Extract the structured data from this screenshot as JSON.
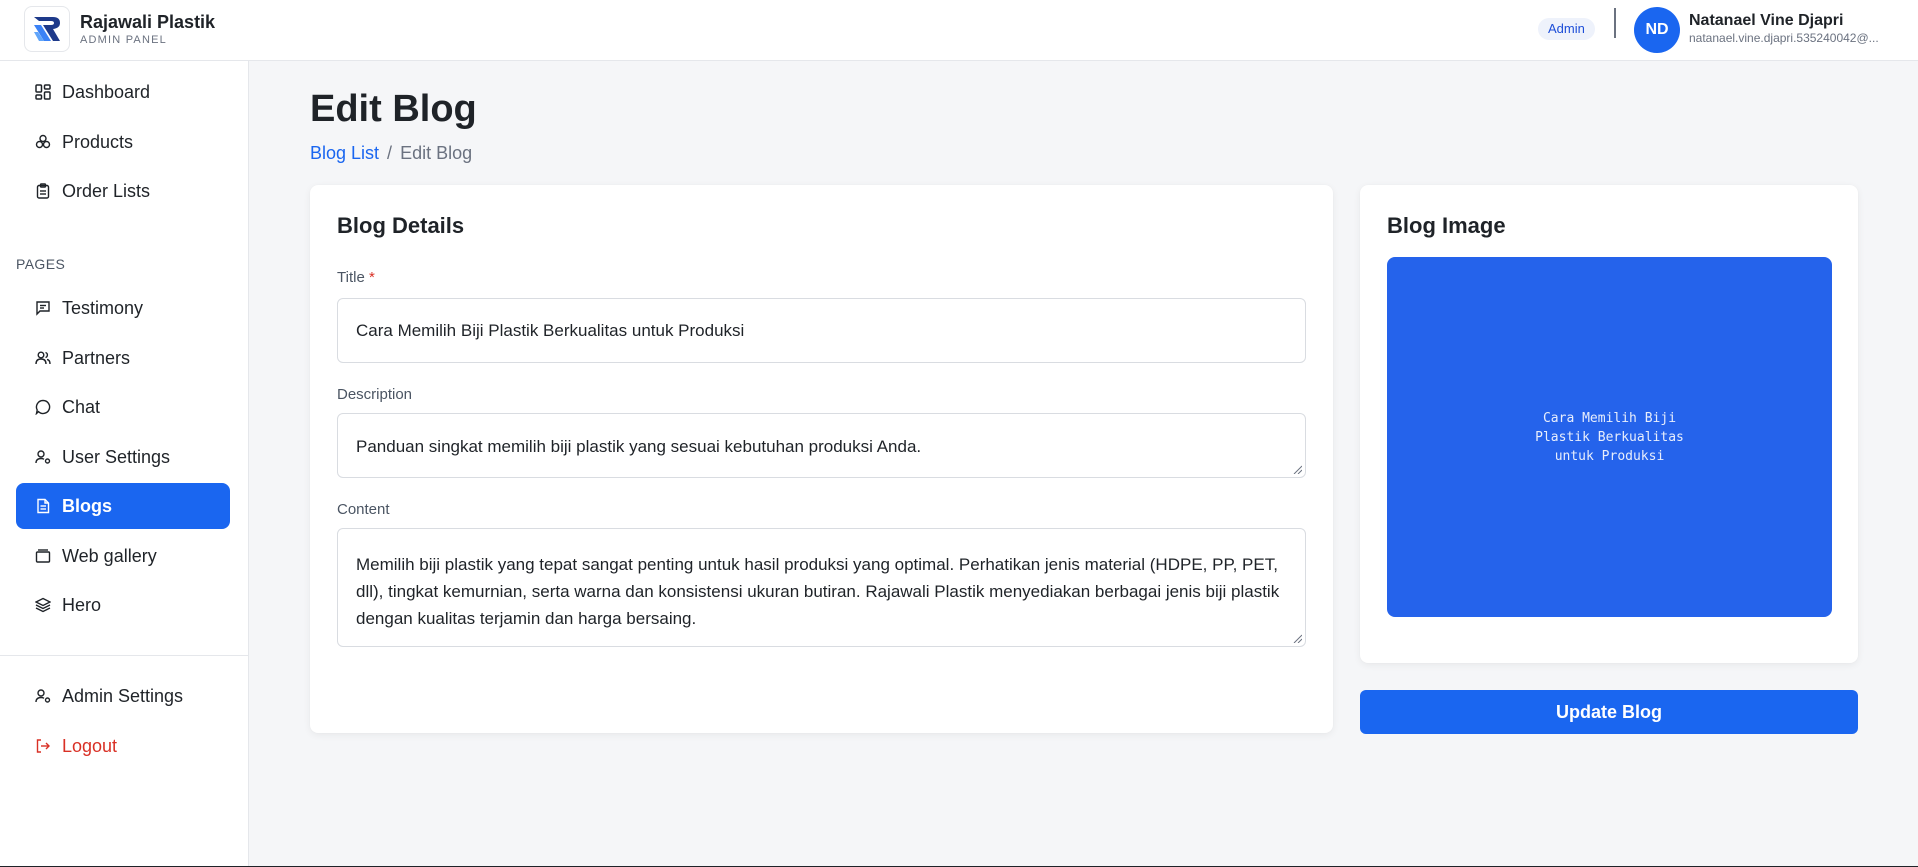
{
  "brand": {
    "name": "Rajawali Plastik",
    "subtitle": "ADMIN PANEL"
  },
  "header": {
    "role": "Admin",
    "user_initials": "ND",
    "user_name": "Natanael Vine Djapri",
    "user_email": "natanael.vine.djapri.535240042@..."
  },
  "sidebar": {
    "main_items": [
      {
        "label": "Dashboard",
        "icon": "dashboard-icon"
      },
      {
        "label": "Products",
        "icon": "products-icon"
      },
      {
        "label": "Order Lists",
        "icon": "clipboard-icon"
      }
    ],
    "section_label": "PAGES",
    "page_items": [
      {
        "label": "Testimony",
        "icon": "message-square-icon"
      },
      {
        "label": "Partners",
        "icon": "users-icon"
      },
      {
        "label": "Chat",
        "icon": "chat-bubble-icon"
      },
      {
        "label": "User Settings",
        "icon": "user-cog-icon"
      },
      {
        "label": "Blogs",
        "icon": "file-text-icon",
        "active": true
      },
      {
        "label": "Web gallery",
        "icon": "gallery-icon"
      },
      {
        "label": "Hero",
        "icon": "layers-icon"
      }
    ],
    "bottom_items": [
      {
        "label": "Admin Settings",
        "icon": "user-cog-icon"
      },
      {
        "label": "Logout",
        "icon": "logout-icon"
      }
    ]
  },
  "page": {
    "title": "Edit Blog",
    "breadcrumb_link": "Blog List",
    "breadcrumb_sep": "/",
    "breadcrumb_current": "Edit Blog"
  },
  "details": {
    "card_title": "Blog Details",
    "title_label": "Title",
    "required_mark": "*",
    "title_value": "Cara Memilih Biji Plastik Berkualitas untuk Produksi",
    "description_label": "Description",
    "description_value": "Panduan singkat memilih biji plastik yang sesuai kebutuhan produksi Anda.",
    "content_label": "Content",
    "content_value": "Memilih biji plastik yang tepat sangat penting untuk hasil produksi yang optimal. Perhatikan jenis material (HDPE, PP, PET, dll), tingkat kemurnian, serta warna dan konsistensi ukuran butiran. Rajawali Plastik menyediakan berbagai jenis biji plastik dengan kualitas terjamin dan harga bersaing."
  },
  "image_card": {
    "card_title": "Blog Image",
    "preview_text": "Cara Memilih Biji Plastik Berkualitas untuk Produksi",
    "preview_color": "#2563eb"
  },
  "actions": {
    "update_label": "Update Blog"
  },
  "colors": {
    "accent": "#1a66f0",
    "danger": "#d93025"
  }
}
